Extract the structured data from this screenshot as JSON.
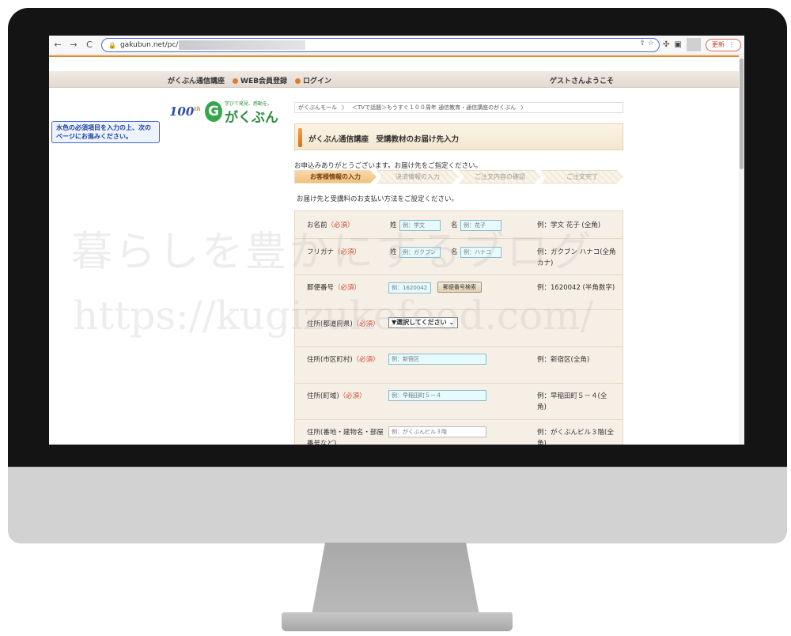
{
  "browser": {
    "url_visible": "gakubun.net/pc/",
    "update_label": "更新",
    "back_icon": "←",
    "forward_icon": "→",
    "reload_icon": "C"
  },
  "site": {
    "nav": [
      "がくぶん通信講座",
      "WEB会員登録",
      "ログイン"
    ],
    "welcome": "ゲストさんようこそ",
    "notice": "水色の必須項目を入力の上、次のページにお進みください。",
    "logo": {
      "anniv": "100",
      "tagline": "学びで発見、感動を。",
      "name": "がくぶん"
    },
    "breadcrumb": [
      "がくぶんモール",
      "＜TVで話題＞もうすぐ１００周年 通信教育・通信講座のがくぶん"
    ],
    "title": "がくぶん通信講座　受講教材のお届け先入力",
    "thanks": "お申込みありがとうございます。お届け先をご指定ください。",
    "steps": [
      "お客様情報の入力",
      "決済情報の入力",
      "ご注文内容の確認",
      "ご注文完了"
    ],
    "instruction": "お届け先と受講料のお支払い方法をご設定ください。"
  },
  "form": {
    "req": "（必須）",
    "name": {
      "label": "お名前",
      "sei": "姓",
      "mei": "名",
      "sei_ph": "例：学文",
      "mei_ph": "例：花子",
      "example": "例：学文 花子 (全角)"
    },
    "kana": {
      "label": "フリガナ",
      "sei": "姓",
      "mei": "名",
      "sei_ph": "例：ガクブン",
      "mei_ph": "例：ハナコ",
      "example": "例：ガクブン ハナコ(全角カナ)"
    },
    "zip": {
      "label": "郵便番号",
      "ph": "例：1620042",
      "button": "郵便番号検索",
      "example": "例：1620042 (半角数字)"
    },
    "pref": {
      "label": "住所(都道府県)",
      "select": "▼選択してください ⌄"
    },
    "city": {
      "label": "住所(市区町村)",
      "ph": "例：新宿区",
      "example": "例：新宿区(全角)"
    },
    "town": {
      "label": "住所(町域)",
      "ph": "例：早稲田町５－４",
      "example": "例：早稲田町５－４(全角)"
    },
    "addr": {
      "label": "住所(番地・建物名・部屋番号など)",
      "ph": "例：がくぶんビル３階",
      "example": "例：がくぶんビル３階(全角)"
    }
  },
  "watermark": {
    "line1": "暮らしを豊かにするブログ",
    "line2": "https://kugizukefood.com/"
  }
}
